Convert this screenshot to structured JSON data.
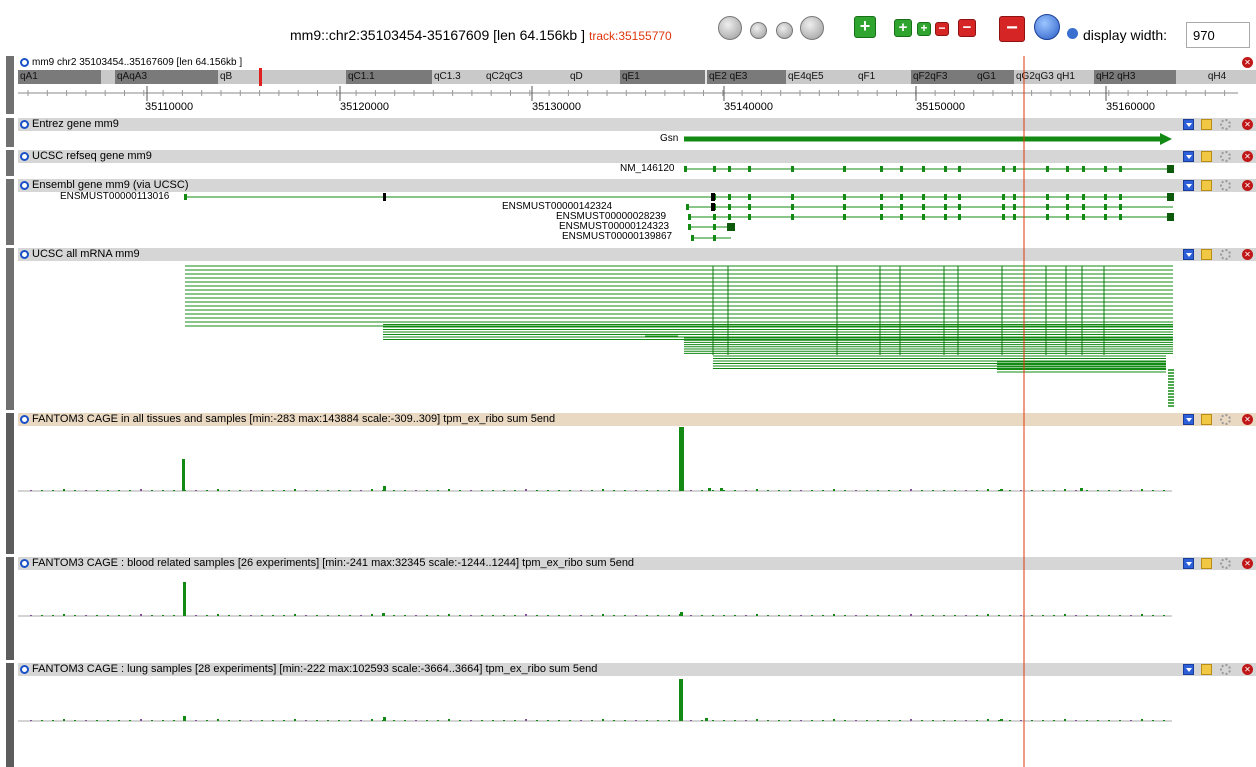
{
  "header": {
    "locus": "mm9::chr2:35103454-35167609 [len 64.156kb ]",
    "track_label": "track:35155770",
    "display_width_label": "display width:",
    "display_width_value": "970"
  },
  "controls": {
    "nav_icons": [
      "scroll-left-fast-icon",
      "scroll-left-icon",
      "scroll-right-icon",
      "scroll-right-fast-icon"
    ],
    "zoom_in_icons": [
      "zoom-in-large-icon",
      "zoom-in-medium-icon",
      "zoom-in-small-icon"
    ],
    "zoom_out_icons": [
      "zoom-out-small-icon",
      "zoom-out-medium-icon",
      "zoom-out-large-icon"
    ],
    "reload_icon": "reload-icon",
    "help_icon": "help-icon"
  },
  "ruler": {
    "title": "mm9 chr2 35103454..35167609 [len 64.156kb ]",
    "bands": [
      "qA1",
      "qAqA3",
      "qB",
      "qC1.1",
      "qC1.3",
      "qC2qC3",
      "qD",
      "qE1",
      "qE2 qE3",
      "qE4qE5",
      "qF1",
      "qF2qF3",
      "qG1",
      "qG2qG3 qH1",
      "qH2 qH3",
      "qH4"
    ],
    "ticks": [
      "35110000",
      "35120000",
      "35130000",
      "35140000",
      "35150000",
      "35160000"
    ]
  },
  "tracks": [
    {
      "title": "Entrez gene mm9",
      "labels": [
        "Gsn"
      ]
    },
    {
      "title": "UCSC refseq gene mm9",
      "labels": [
        "NM_146120"
      ]
    },
    {
      "title": "Ensembl gene mm9 (via UCSC)",
      "labels": [
        "ENSMUST00000113016",
        "ENSMUST00000142324",
        "ENSMUST00000028239",
        "ENSMUST00000124323",
        "ENSMUST00000139867"
      ]
    },
    {
      "title": "UCSC all mRNA mm9"
    },
    {
      "title": "FANTOM3 CAGE in all tissues and samples [min:-283 max:143884 scale:-309..309] tpm_ex_ribo sum 5end"
    },
    {
      "title": "FANTOM3 CAGE : blood related samples [26 experiments] [min:-241 max:32345 scale:-1244..1244] tpm_ex_ribo sum 5end"
    },
    {
      "title": "FANTOM3 CAGE : lung samples [28 experiments] [min:-222 max:102593 scale:-3664..3664] tpm_ex_ribo sum 5end"
    }
  ],
  "track_icons": [
    "download-icon",
    "config-icon",
    "gear-icon",
    "close-icon"
  ],
  "colors": {
    "feature_green": "#138a13",
    "cursor_line": "#e0360c",
    "track_header": "#d6d6d6",
    "cage_header": "#ead9c2",
    "link_blue": "#1850c8"
  }
}
